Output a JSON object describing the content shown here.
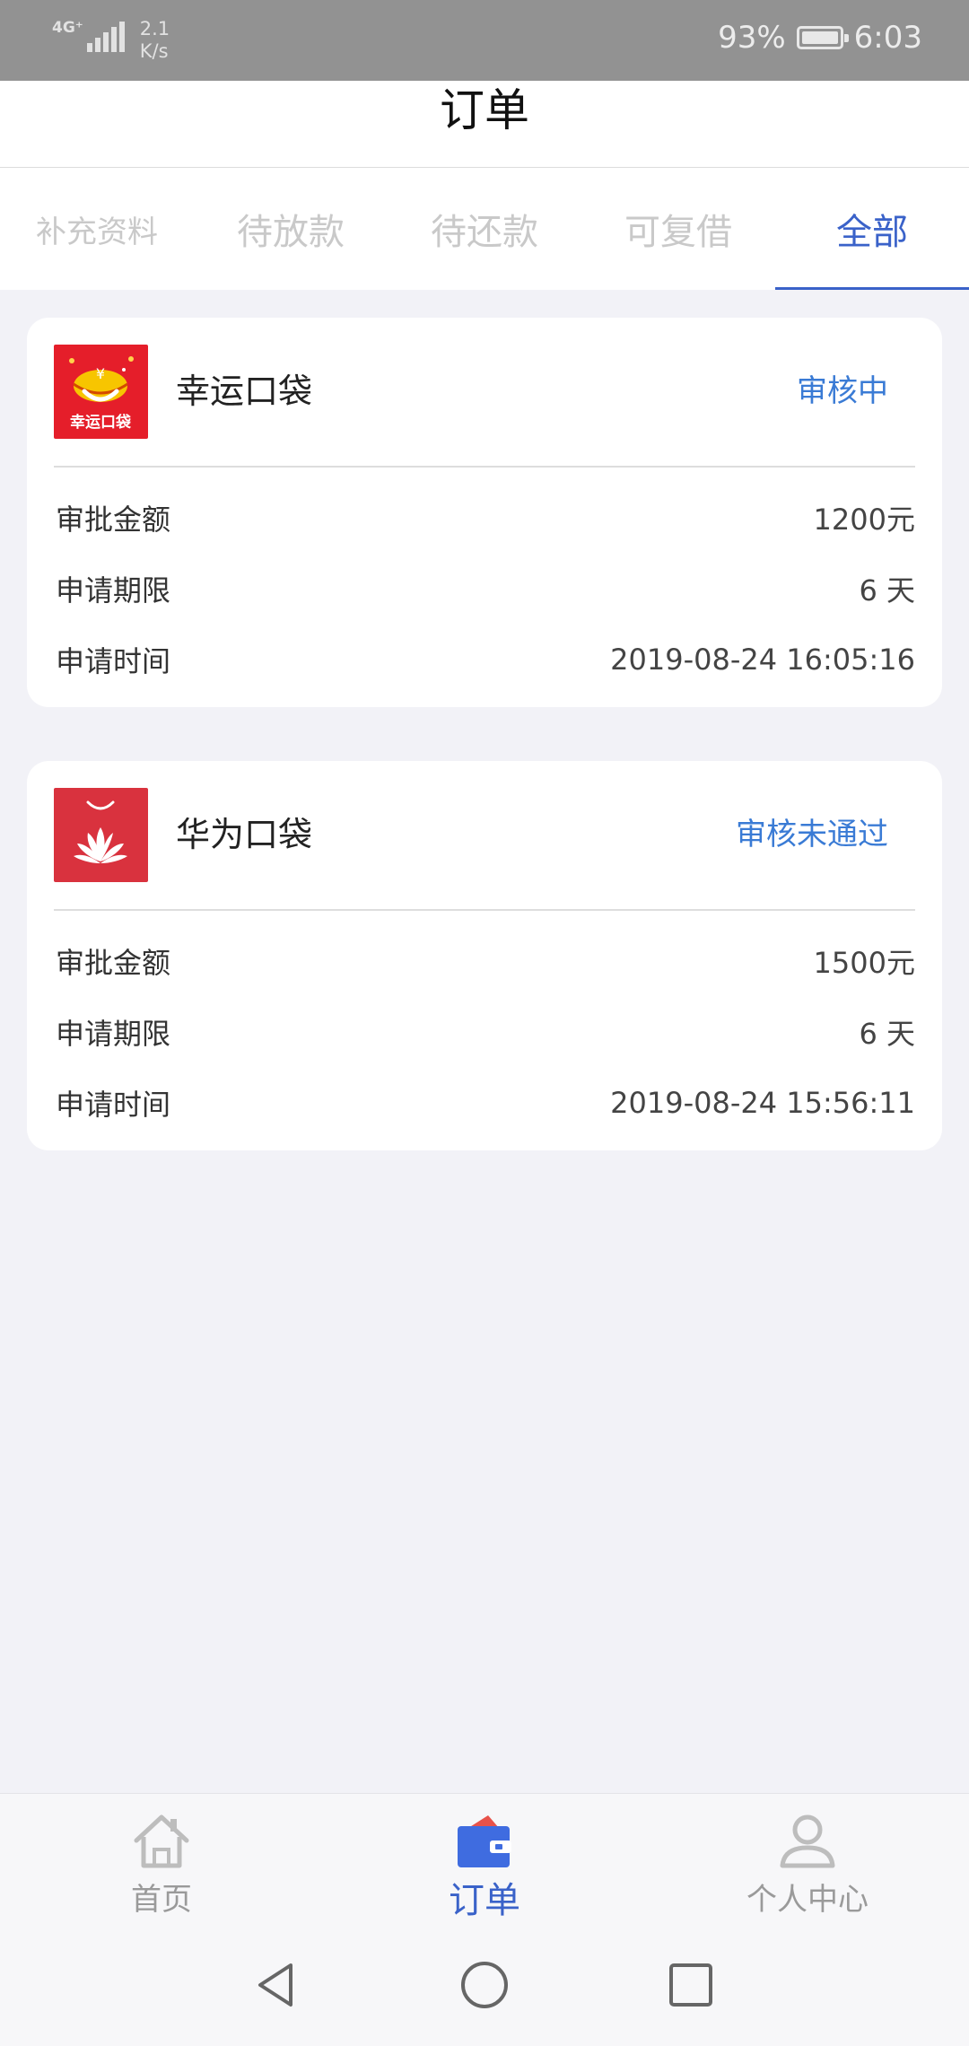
{
  "statusbar": {
    "network": "4G⁺",
    "speed_value": "2.1",
    "speed_unit": "K/s",
    "battery": "93%",
    "time": "6:03"
  },
  "header": {
    "title": "订单"
  },
  "tabs": [
    {
      "label": "补充资料",
      "active": false
    },
    {
      "label": "待放款",
      "active": false
    },
    {
      "label": "待还款",
      "active": false
    },
    {
      "label": "可复借",
      "active": false
    },
    {
      "label": "全部",
      "active": true
    }
  ],
  "orders": [
    {
      "app_name": "幸运口袋",
      "logo_icon": "lucky-pocket-logo",
      "logo_text": "幸运口袋",
      "status": "审核中",
      "rows": [
        {
          "label": "审批金额",
          "value": "1200元"
        },
        {
          "label": "申请期限",
          "value": "6 天"
        },
        {
          "label": "申请时间",
          "value": "2019-08-24 16:05:16"
        }
      ]
    },
    {
      "app_name": "华为口袋",
      "logo_icon": "huawei-pocket-logo",
      "status": "审核未通过",
      "rows": [
        {
          "label": "审批金额",
          "value": "1500元"
        },
        {
          "label": "申请期限",
          "value": "6 天"
        },
        {
          "label": "申请时间",
          "value": "2019-08-24 15:56:11"
        }
      ]
    }
  ],
  "bottom_nav": [
    {
      "label": "首页",
      "icon": "home-icon",
      "active": false
    },
    {
      "label": "订单",
      "icon": "wallet-icon",
      "active": true
    },
    {
      "label": "个人中心",
      "icon": "user-icon",
      "active": false
    }
  ],
  "colors": {
    "accent": "#3a62c9",
    "status_blue": "#3a7bd5",
    "page_bg": "#f2f2f7",
    "statusbar_bg": "#929292",
    "lucky_red": "#e51e2a",
    "huawei_red": "#d9323e"
  }
}
